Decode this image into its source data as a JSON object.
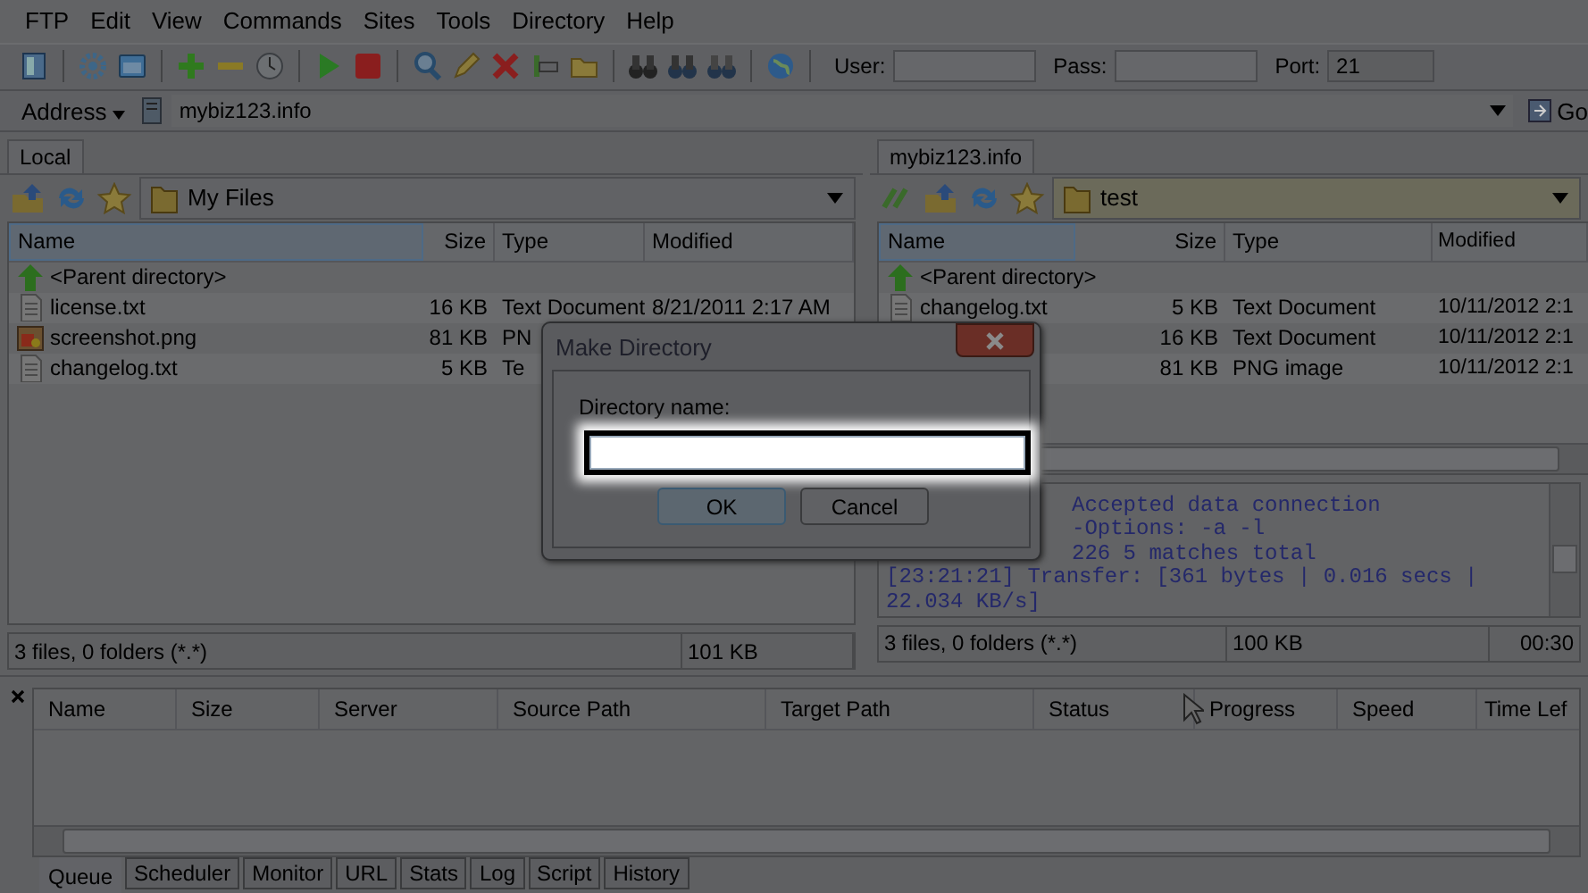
{
  "menu": [
    {
      "label": "FTP"
    },
    {
      "label": "Edit"
    },
    {
      "label": "View"
    },
    {
      "label": "Commands"
    },
    {
      "label": "Sites"
    },
    {
      "label": "Tools"
    },
    {
      "label": "Directory"
    },
    {
      "label": "Help"
    }
  ],
  "login": {
    "user_label": "User:",
    "pass_label": "Pass:",
    "port_label": "Port:",
    "port": "21"
  },
  "address": {
    "label": "Address",
    "value": "mybiz123.info",
    "go": "Go"
  },
  "local": {
    "tab": "Local",
    "path": "My Files",
    "columns": [
      "Name",
      "Size",
      "Type",
      "Modified"
    ],
    "rows": [
      {
        "kind": "parent",
        "name": "<Parent directory>"
      },
      {
        "kind": "text",
        "name": "license.txt",
        "size": "16 KB",
        "type": "Text Document",
        "modified": "8/21/2011 2:17 AM"
      },
      {
        "kind": "image",
        "name": "screenshot.png",
        "size": "81 KB",
        "type": "PN"
      },
      {
        "kind": "text",
        "name": "changelog.txt",
        "size": "5 KB",
        "type": "Te"
      }
    ],
    "status": [
      "3 files, 0 folders (*.*)",
      "101 KB"
    ]
  },
  "remote": {
    "tab": "mybiz123.info",
    "path": "test",
    "columns": [
      "Name",
      "Size",
      "Type",
      "Modified"
    ],
    "rows": [
      {
        "kind": "parent",
        "name": "<Parent directory>"
      },
      {
        "kind": "text",
        "name": "changelog.txt",
        "size": "5 KB",
        "type": "Text Document",
        "modified": "10/11/2012 2:1"
      },
      {
        "kind": "hidden",
        "size": "16 KB",
        "type": "Text Document",
        "modified": "10/11/2012 2:1"
      },
      {
        "kind": "hidden",
        "size": "81 KB",
        "type": "PNG image",
        "modified": "10/11/2012 2:1"
      }
    ],
    "log": [
      {
        "kind": "cut",
        "text": "Accepted data connection"
      },
      {
        "kind": "cut",
        "text": "-Options: -a -l"
      },
      {
        "kind": "cut",
        "text": "226 5 matches total"
      },
      {
        "kind": "full",
        "text": "[23:21:21] Transfer: [361 bytes | 0.016 secs |"
      },
      {
        "kind": "full",
        "text": "22.034 KB/s]"
      }
    ],
    "status": [
      "3 files, 0 folders (*.*)",
      "100 KB",
      "00:30"
    ]
  },
  "queue": {
    "columns": [
      "Name",
      "Size",
      "Server",
      "Source Path",
      "Target Path",
      "Status",
      "Progress",
      "Speed",
      "Time Lef"
    ],
    "tabs": [
      {
        "label": "Queue",
        "selected": true
      },
      {
        "label": "Scheduler",
        "selected": false
      },
      {
        "label": "Monitor",
        "selected": false
      },
      {
        "label": "URL",
        "selected": false
      },
      {
        "label": "Stats",
        "selected": false
      },
      {
        "label": "Log",
        "selected": false
      },
      {
        "label": "Script",
        "selected": false
      },
      {
        "label": "History",
        "selected": false
      }
    ]
  },
  "dialog": {
    "title": "Make Directory",
    "label": "Directory name:",
    "ok": "OK",
    "cancel": "Cancel"
  }
}
